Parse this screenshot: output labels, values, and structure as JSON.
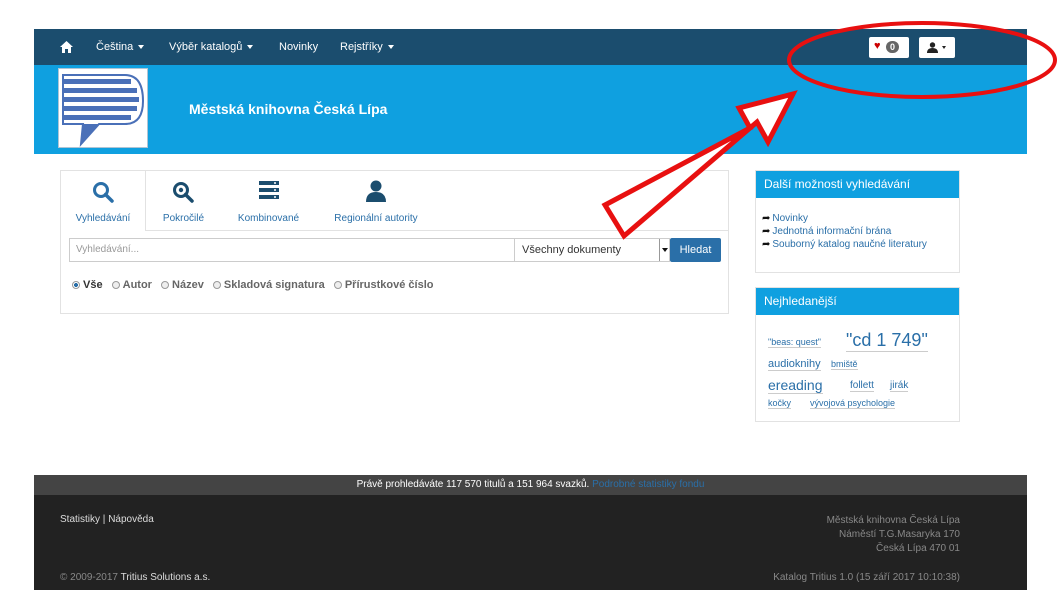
{
  "nav": {
    "language": "Čeština",
    "catalog_select": "Výběr katalogů",
    "news": "Novinky",
    "registers": "Rejstříky",
    "favorites_count": "0"
  },
  "banner": {
    "title": "Městská knihovna Česká Lípa"
  },
  "search": {
    "tabs": [
      "Vyhledávání",
      "Pokročilé",
      "Kombinované",
      "Regionální autority"
    ],
    "placeholder": "Vyhledávání...",
    "doc_type": "Všechny dokumenty",
    "button": "Hledat",
    "radios": [
      "Vše",
      "Autor",
      "Název",
      "Skladová signatura",
      "Přírustkové číslo"
    ]
  },
  "more_options": {
    "title": "Další možnosti vyhledávání",
    "links": [
      "Novinky",
      "Jednotná informační brána",
      "Souborný katalog naučné literatury"
    ]
  },
  "popular": {
    "title": "Nejhledanější",
    "tags": [
      "\"beas: quest\"",
      "\"cd 1 749\"",
      "audioknihy",
      "bmiště",
      "ereading",
      "follett",
      "jirák",
      "kočky",
      "vývojová psychologie"
    ]
  },
  "status": {
    "text": "Právě prohledáváte 117 570 titulů a 151 964 svazků.",
    "link": "Podrobné statistiky fondu"
  },
  "footer": {
    "stats": "Statistiky",
    "separator": "|",
    "help": "Nápověda",
    "address_line1": "Městská knihovna Česká Lípa",
    "address_line2": "Náměstí T.G.Masaryka 170",
    "address_line3": "Česká Lípa 470 01",
    "copyright_prefix": "© 2009-2017",
    "copyright_company": "Tritius Solutions a.s.",
    "version": "Katalog Tritius 1.0 (15 září 2017 10:10:38)"
  },
  "colors": {
    "navbar": "#1b4d6e",
    "banner": "#0fa0e0",
    "link": "#2a6fa8",
    "footer": "#222222",
    "annotation": "#e81010"
  }
}
